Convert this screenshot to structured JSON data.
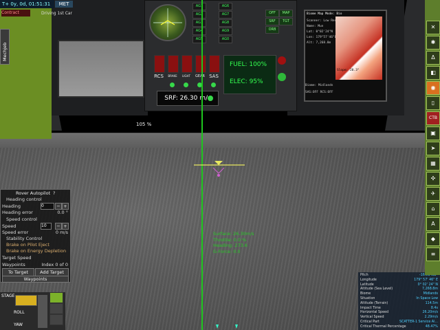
{
  "met": {
    "time": "T+ 0y, 0d, 01:51:31",
    "button": "MET"
  },
  "top_left": {
    "contract_text": "Contract",
    "vessel_label": "Driving 1st Car"
  },
  "mechjeb_tab": "Mechjeb",
  "zoom_label": "105 %",
  "cockpit": {
    "annunciators_left": [
      "AG1",
      "AG2",
      "AG3",
      "AG4",
      "AG5"
    ],
    "annunciators_right": [
      "AG6",
      "AG7",
      "AG8",
      "AG9",
      "AG0"
    ],
    "switch_labels": [
      "RCS",
      "BRAKE",
      "LIGHT",
      "GEAR",
      "SAS"
    ],
    "fuel": "FUEL: 100%",
    "elec": "ELEC:  95%",
    "srf": "SRF: 26.30 m/s",
    "mode_buttons": [
      "OFF",
      "MAP",
      "SRF",
      "TGT",
      "ORB"
    ]
  },
  "mfd": {
    "header": "Biome Map   Mode: Bio",
    "lines": [
      "Scanner: Low Res",
      "Name: Mun",
      "Lat: 0°02'24\"N",
      "Lon: 179°57'46\"E",
      "Alt: 7,268.8m",
      "Slope: 28.3°",
      "Biome: Midlands",
      "SAS:OFF  RCS:OFF"
    ]
  },
  "hud_readout": {
    "surface": "Surface: 26.30m/s",
    "throttle": "Throttle: 0.0 %",
    "heading": "Heading: 273.6",
    "g_force": "G-Force: 0.0"
  },
  "rover_autopilot": {
    "title": "Rover Autopilot",
    "help": "?",
    "heading_control": "Heading control",
    "heading_label": "Heading",
    "heading_value": "0",
    "heading_error_label": "Heading error",
    "heading_error_value": "0.0 °",
    "speed_control": "Speed control",
    "speed_label": "Speed",
    "speed_value": "10",
    "speed_error_label": "Speed error",
    "speed_error_value": "0 m/s",
    "stability_control": "Stability Control",
    "brake_pilot_eject": "Brake on Pilot Eject",
    "brake_energy": "Brake on Energy Depletion",
    "target_speed_label": "Target Speed",
    "waypoints_label": "Waypoints",
    "waypoints_index": "Index 0 of 0",
    "to_target": "To Target",
    "add_target": "Add Target",
    "waypoints_button": "Waypoints"
  },
  "flight_info": {
    "rows": [
      {
        "label": "Pitch",
        "value": "-16.51482°"
      },
      {
        "label": "Longitude",
        "value": "179° 57' 46\" E"
      },
      {
        "label": "Latitude",
        "value": "0° 02' 24\" N"
      },
      {
        "label": "Altitude (Sea Level)",
        "value": "7,268.8m"
      },
      {
        "label": "Biome",
        "value": "Midlands"
      },
      {
        "label": "Situation",
        "value": "In Space Low"
      },
      {
        "label": "Altitude (Terrain)",
        "value": "114.5m"
      },
      {
        "label": "Impact Time",
        "value": "8.4s"
      },
      {
        "label": "Horizontal Speed",
        "value": "26.20m/s"
      },
      {
        "label": "Vertical Speed",
        "value": "2.29m/s"
      },
      {
        "label": "Critical Part",
        "value": "SCATTER-1 Service Al..."
      },
      {
        "label": "Critical Thermal Percentage",
        "value": "48.47%"
      }
    ]
  },
  "staging": {
    "stage_label": "STAGE",
    "roll_label": "ROLL",
    "yaw_label": "YAW"
  },
  "toolbar": [
    "CTB"
  ],
  "colors": {
    "hud_green": "#1ec61e",
    "toolbar_green": "#5e7e2c",
    "value_blue": "#4fd0ff"
  }
}
